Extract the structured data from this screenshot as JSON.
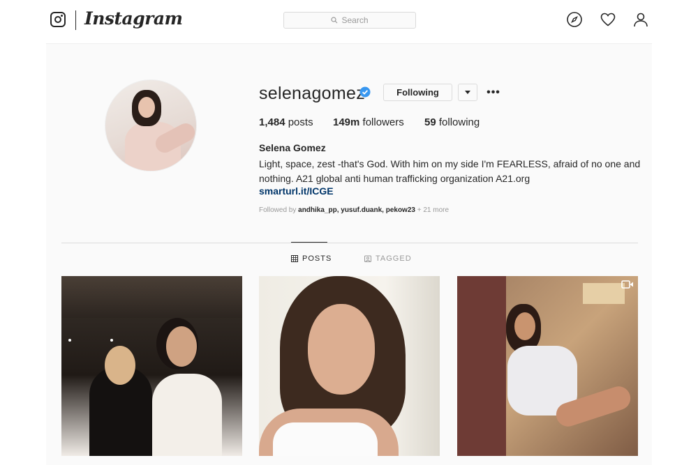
{
  "brand": {
    "wordmark": "Instagram"
  },
  "nav": {
    "search_placeholder": "Search",
    "icons": [
      "instagram-logo-icon",
      "compass-icon",
      "heart-icon",
      "profile-icon"
    ]
  },
  "profile": {
    "username": "selenagomez",
    "verified": true,
    "following_label": "Following",
    "more_label": "•••",
    "stats": [
      {
        "value": "1,484",
        "label": "posts"
      },
      {
        "value": "149m",
        "label": "followers"
      },
      {
        "value": "59",
        "label": "following"
      }
    ],
    "full_name": "Selena Gomez",
    "bio": "Light, space, zest -that's God. With him on my side I'm FEARLESS, afraid of no one and nothing. A21 global anti human trafficking organization A21.org",
    "link": "smarturl.it/ICGE",
    "followed_by_prefix": "Followed by",
    "followed_by_users": "andhika_pp, yusuf.duank, pekow23",
    "followed_by_more": "+ 21 more"
  },
  "tabs": [
    {
      "label": "POSTS",
      "active": true,
      "icon": "grid-icon"
    },
    {
      "label": "TAGGED",
      "active": false,
      "icon": "tagged-icon"
    }
  ],
  "colors": {
    "text": "#262626",
    "link": "#003569",
    "verified": "#3897f0",
    "muted": "#999999",
    "border": "#dbdbdb"
  }
}
